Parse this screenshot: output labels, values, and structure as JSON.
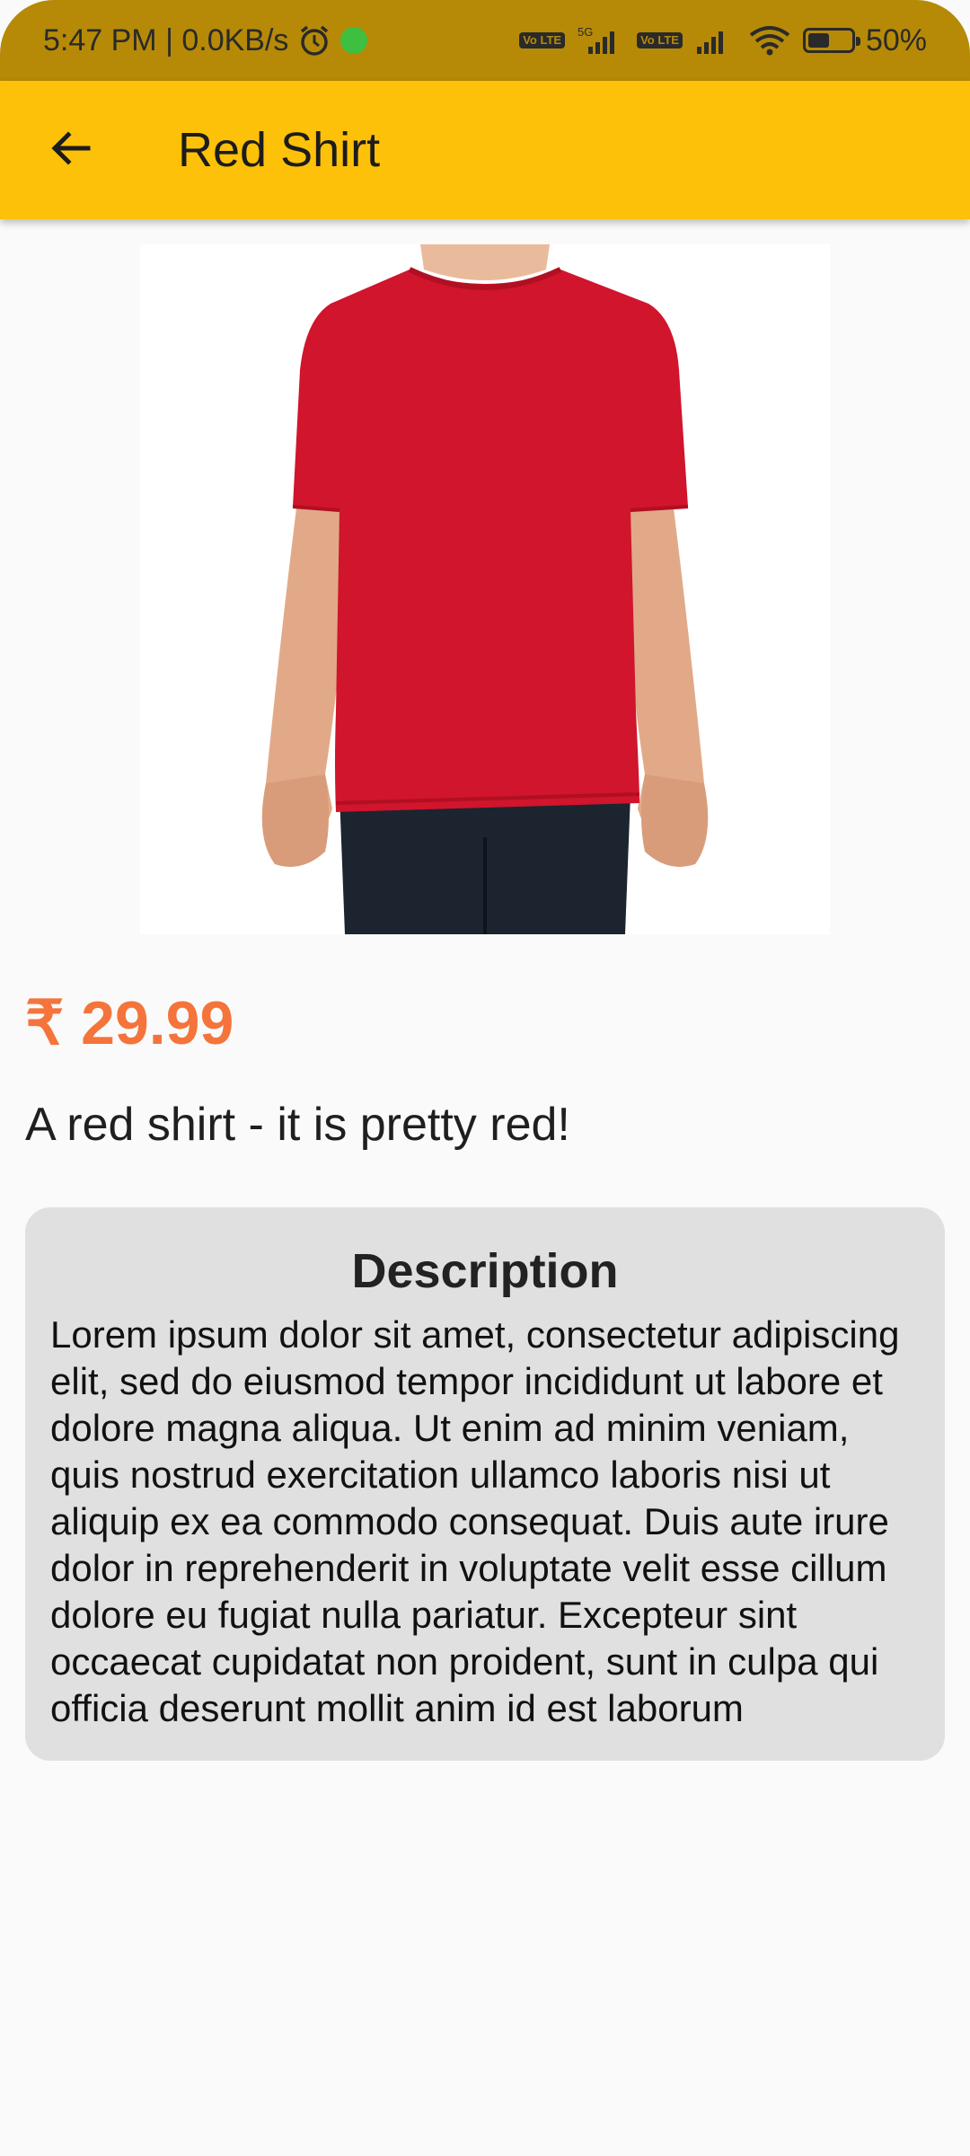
{
  "status_bar": {
    "time_info": "5:47 PM | 0.0KB/s",
    "network_5g": "5G",
    "volte_label": "Vo LTE",
    "battery_percent": "50%",
    "battery_level": 0.5
  },
  "app_bar": {
    "title": "Red Shirt",
    "back_icon": "arrow-left-icon"
  },
  "product": {
    "image_alt": "red t-shirt",
    "price": "₹ 29.99",
    "subtitle": "A red shirt - it is pretty red!",
    "description_title": "Description",
    "description": "Lorem ipsum dolor sit amet, consectetur adipiscing elit, sed do eiusmod tempor incididunt ut labore et dolore magna aliqua. Ut enim ad minim veniam, quis nostrud exercitation ullamco laboris nisi ut aliquip ex ea commodo consequat. Duis aute irure dolor in reprehenderit in voluptate velit esse cillum dolore eu fugiat nulla pariatur. Excepteur sint occaecat cupidatat non proident, sunt in culpa qui officia deserunt mollit anim id est laborum"
  },
  "colors": {
    "app_bar": "#fec109",
    "status_bar": "#b68a06",
    "price": "#f4743b",
    "shirt": "#d0152c"
  }
}
